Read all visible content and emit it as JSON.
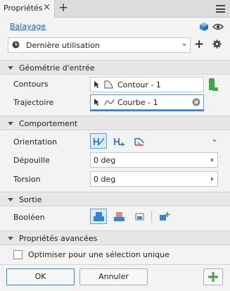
{
  "tab": {
    "title": "Propriétés",
    "close": "×",
    "add": "+"
  },
  "header": {
    "feature_link": "Balayage"
  },
  "preset": {
    "value": "Dernière utilisation"
  },
  "sections": {
    "geometry": "Géométrie d'entrée",
    "behavior": "Comportement",
    "output": "Sortie",
    "advanced": "Propriétés avancées"
  },
  "geometry": {
    "profile_label": "Contours",
    "profile_value": "Contour - 1",
    "path_label": "Trajectoire",
    "path_value": "Courbe - 1"
  },
  "behavior": {
    "orientation_label": "Orientation",
    "taper_label": "Dépouille",
    "taper_value": "0 deg",
    "twist_label": "Torsion",
    "twist_value": "0 deg"
  },
  "output": {
    "boolean_label": "Booléen"
  },
  "advanced": {
    "optimize_label": "Optimiser pour une sélection unique",
    "optimize_checked": false
  },
  "buttons": {
    "ok": "OK",
    "cancel": "Annuler",
    "apply": "+"
  },
  "colors": {
    "accent": "#2f86d8",
    "link": "#0a64c8",
    "green": "#3ca84b",
    "panel": "#f3f3f3"
  }
}
